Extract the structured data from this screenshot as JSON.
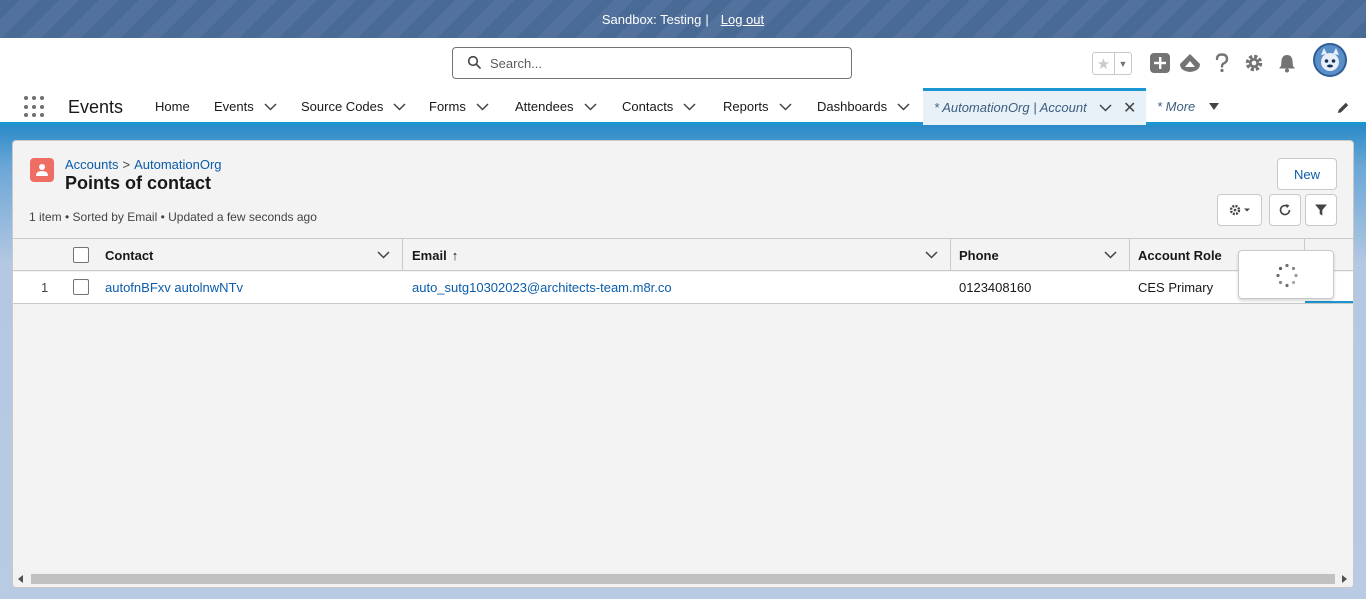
{
  "banner": {
    "sandbox_text": "Sandbox: Testing",
    "separator": "|",
    "logout": "Log out"
  },
  "search": {
    "placeholder": "Search..."
  },
  "app": {
    "name": "Events"
  },
  "nav": {
    "items": [
      {
        "label": "Home",
        "has_menu": false
      },
      {
        "label": "Events",
        "has_menu": true
      },
      {
        "label": "Source Codes",
        "has_menu": true
      },
      {
        "label": "Forms",
        "has_menu": true
      },
      {
        "label": "Attendees",
        "has_menu": true
      },
      {
        "label": "Contacts",
        "has_menu": true
      },
      {
        "label": "Reports",
        "has_menu": true
      },
      {
        "label": "Dashboards",
        "has_menu": true
      }
    ],
    "active_tab": "* AutomationOrg | Account",
    "more": "* More"
  },
  "list": {
    "breadcrumb": {
      "parent": "Accounts",
      "separator": ">",
      "record": "AutomationOrg"
    },
    "title": "Points of contact",
    "meta": "1 item • Sorted by Email • Updated a few seconds ago",
    "new_button": "New",
    "columns": {
      "contact": "Contact",
      "email": "Email",
      "email_sort": "↑",
      "phone": "Phone",
      "role": "Account Role"
    },
    "rows": [
      {
        "num": "1",
        "contact": "autofnBFxv autolnwNTv",
        "email": "auto_sutg10302023@architects-team.m8r.co",
        "phone": "0123408160",
        "role": "CES Primary"
      }
    ]
  },
  "colors": {
    "link": "#0b5cab",
    "brand": "#1b96d0",
    "object_icon": "#ef6e64"
  }
}
